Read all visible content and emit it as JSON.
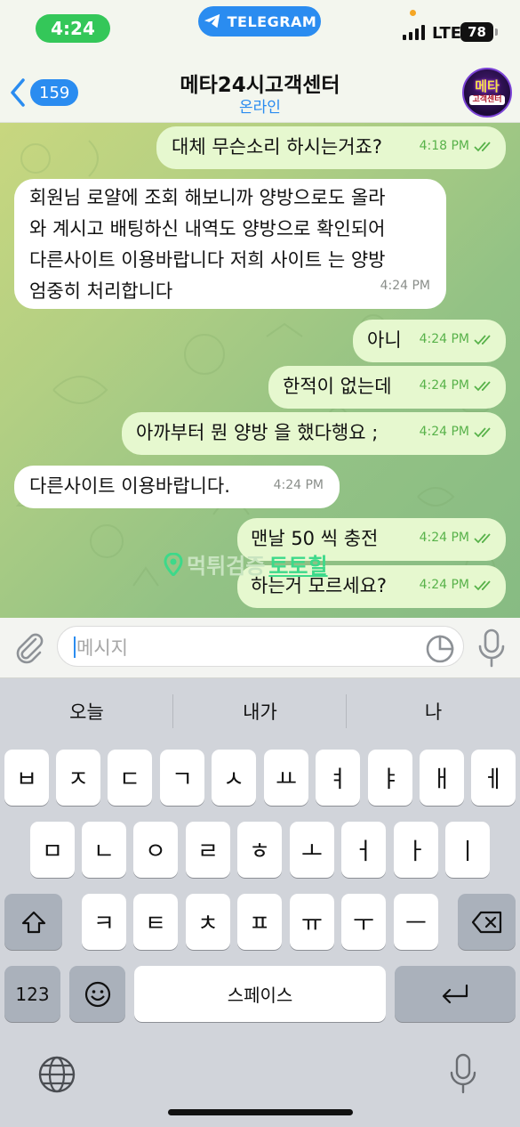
{
  "status_bar": {
    "time": "4:24",
    "center_pill": "TELEGRAM",
    "network": "LTE",
    "battery": "78"
  },
  "header": {
    "back_count": "159",
    "title": "메타24시고객센터",
    "status": "온라인",
    "avatar_line1": "메타",
    "avatar_line2": "고객센터"
  },
  "messages": [
    {
      "dir": "out",
      "text": "대체 무슨소리 하시는거죠?",
      "time": "4:18 PM",
      "read": true
    },
    {
      "dir": "in",
      "text": "회원님 로얄에 조회 해보니까 양방으로도 올라\n와 계시고 배팅하신 내역도 양방으로 확인되어\n다른사이트 이용바랍니다 저희 사이트 는 양방\n엄중히 처리합니다",
      "time": "4:24 PM"
    },
    {
      "dir": "out",
      "text": "아니",
      "time": "4:24 PM",
      "read": true
    },
    {
      "dir": "out",
      "text": "한적이 없는데",
      "time": "4:24 PM",
      "read": true
    },
    {
      "dir": "out",
      "text": "아까부터 뭔 양방 을 했다행요 ;",
      "time": "4:24 PM",
      "read": true
    },
    {
      "dir": "in",
      "text": "다른사이트 이용바랍니다.",
      "time": "4:24 PM"
    },
    {
      "dir": "out",
      "text": "맨날 50 씩 충전",
      "time": "4:24 PM",
      "read": true
    },
    {
      "dir": "out",
      "text": "하는거 모르세요?",
      "time": "4:24 PM",
      "read": true
    }
  ],
  "watermark": {
    "part1": "먹튀검증",
    "part2": "토토힐"
  },
  "composer": {
    "placeholder": "메시지"
  },
  "keyboard": {
    "suggestions": [
      "오늘",
      "내가",
      "나"
    ],
    "row1": [
      "ㅂ",
      "ㅈ",
      "ㄷ",
      "ㄱ",
      "ㅅ",
      "ㅛ",
      "ㅕ",
      "ㅑ",
      "ㅐ",
      "ㅔ"
    ],
    "row2": [
      "ㅁ",
      "ㄴ",
      "ㅇ",
      "ㄹ",
      "ㅎ",
      "ㅗ",
      "ㅓ",
      "ㅏ",
      "ㅣ"
    ],
    "row3": [
      "ㅋ",
      "ㅌ",
      "ㅊ",
      "ㅍ",
      "ㅠ",
      "ㅜ",
      "ㅡ"
    ],
    "numbers_key": "123",
    "space_key": "스페이스"
  },
  "colors": {
    "accent": "#2a8cf0",
    "outgoing_bubble": "#e6f8cf",
    "incoming_bubble": "#ffffff",
    "read_check": "#58b24a",
    "time_pill": "#34c759"
  }
}
